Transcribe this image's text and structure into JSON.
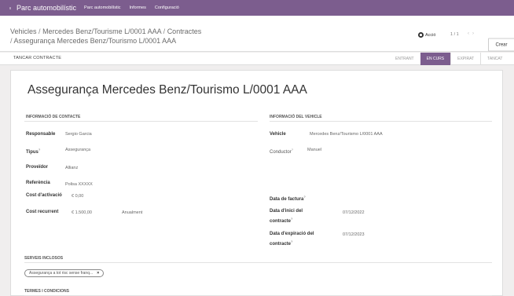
{
  "navbar": {
    "apps_icon": "grid-icon",
    "brand": "Parc automobilístic",
    "menus": [
      "Parc automobilístic",
      "Informes",
      "Configuració"
    ]
  },
  "breadcrumb": {
    "part1": "Vehicles",
    "part2": "Mercedes Benz/Tourisme L/0001 AAA",
    "part3": "Contractes",
    "part4": "Assegurança Mercedes Benz/Tourismo L/0001 AAA"
  },
  "toolbar": {
    "action_label": "Acció",
    "pager": "1 / 1",
    "prev": "‹",
    "next": "›",
    "create_label": "Crear"
  },
  "statusbar": {
    "close_label": "TANCAR CONTRACTE",
    "stages": [
      "ENTRANT",
      "EN CURS",
      "EXPIRAT",
      "TANCAT"
    ],
    "active_stage": "EN CURS"
  },
  "form": {
    "title": "Assegurança Mercedes Benz/Tourismo L/0001 AAA",
    "contact_header": "INFORMACIÓ DE CONTACTE",
    "vehicle_header": "INFORMACIÓ DEL VEHICLE",
    "responsible_label": "Responsable",
    "responsible_value": "Sergio Garcia",
    "type_label": "Tipus",
    "type_value": "Assegurança",
    "provider_label": "Proveïdor",
    "provider_value": "Allianz",
    "reference_label": "Referència",
    "reference_value": "Polisa XXXXX",
    "activation_cost_label": "Cost d'activació",
    "activation_cost_value": "€ 0,00",
    "recurring_cost_label": "Cost recurrent",
    "recurring_cost_value": "€ 1.500,00",
    "recurring_period": "Anualment",
    "vehicle_label": "Vehicle",
    "vehicle_value": "Mercedes Benz/Tourismo L/0001 AAA",
    "driver_label": "Conductor",
    "driver_value": "Manuel",
    "invoice_date_label": "Data de factura",
    "start_date_label_1": "Data d'inici del",
    "start_date_label_2": "contracte",
    "start_date_value": "07/12/2022",
    "end_date_label_1": "Data d'expiració del",
    "end_date_label_2": "contracte",
    "end_date_value": "07/12/2023",
    "services_header": "SERVEIS INCLOSOS",
    "service_tag": "Assegurança a tot risc sense franq...",
    "terms_header": "TERMES I CONDICIONS",
    "help_mark": "?"
  }
}
